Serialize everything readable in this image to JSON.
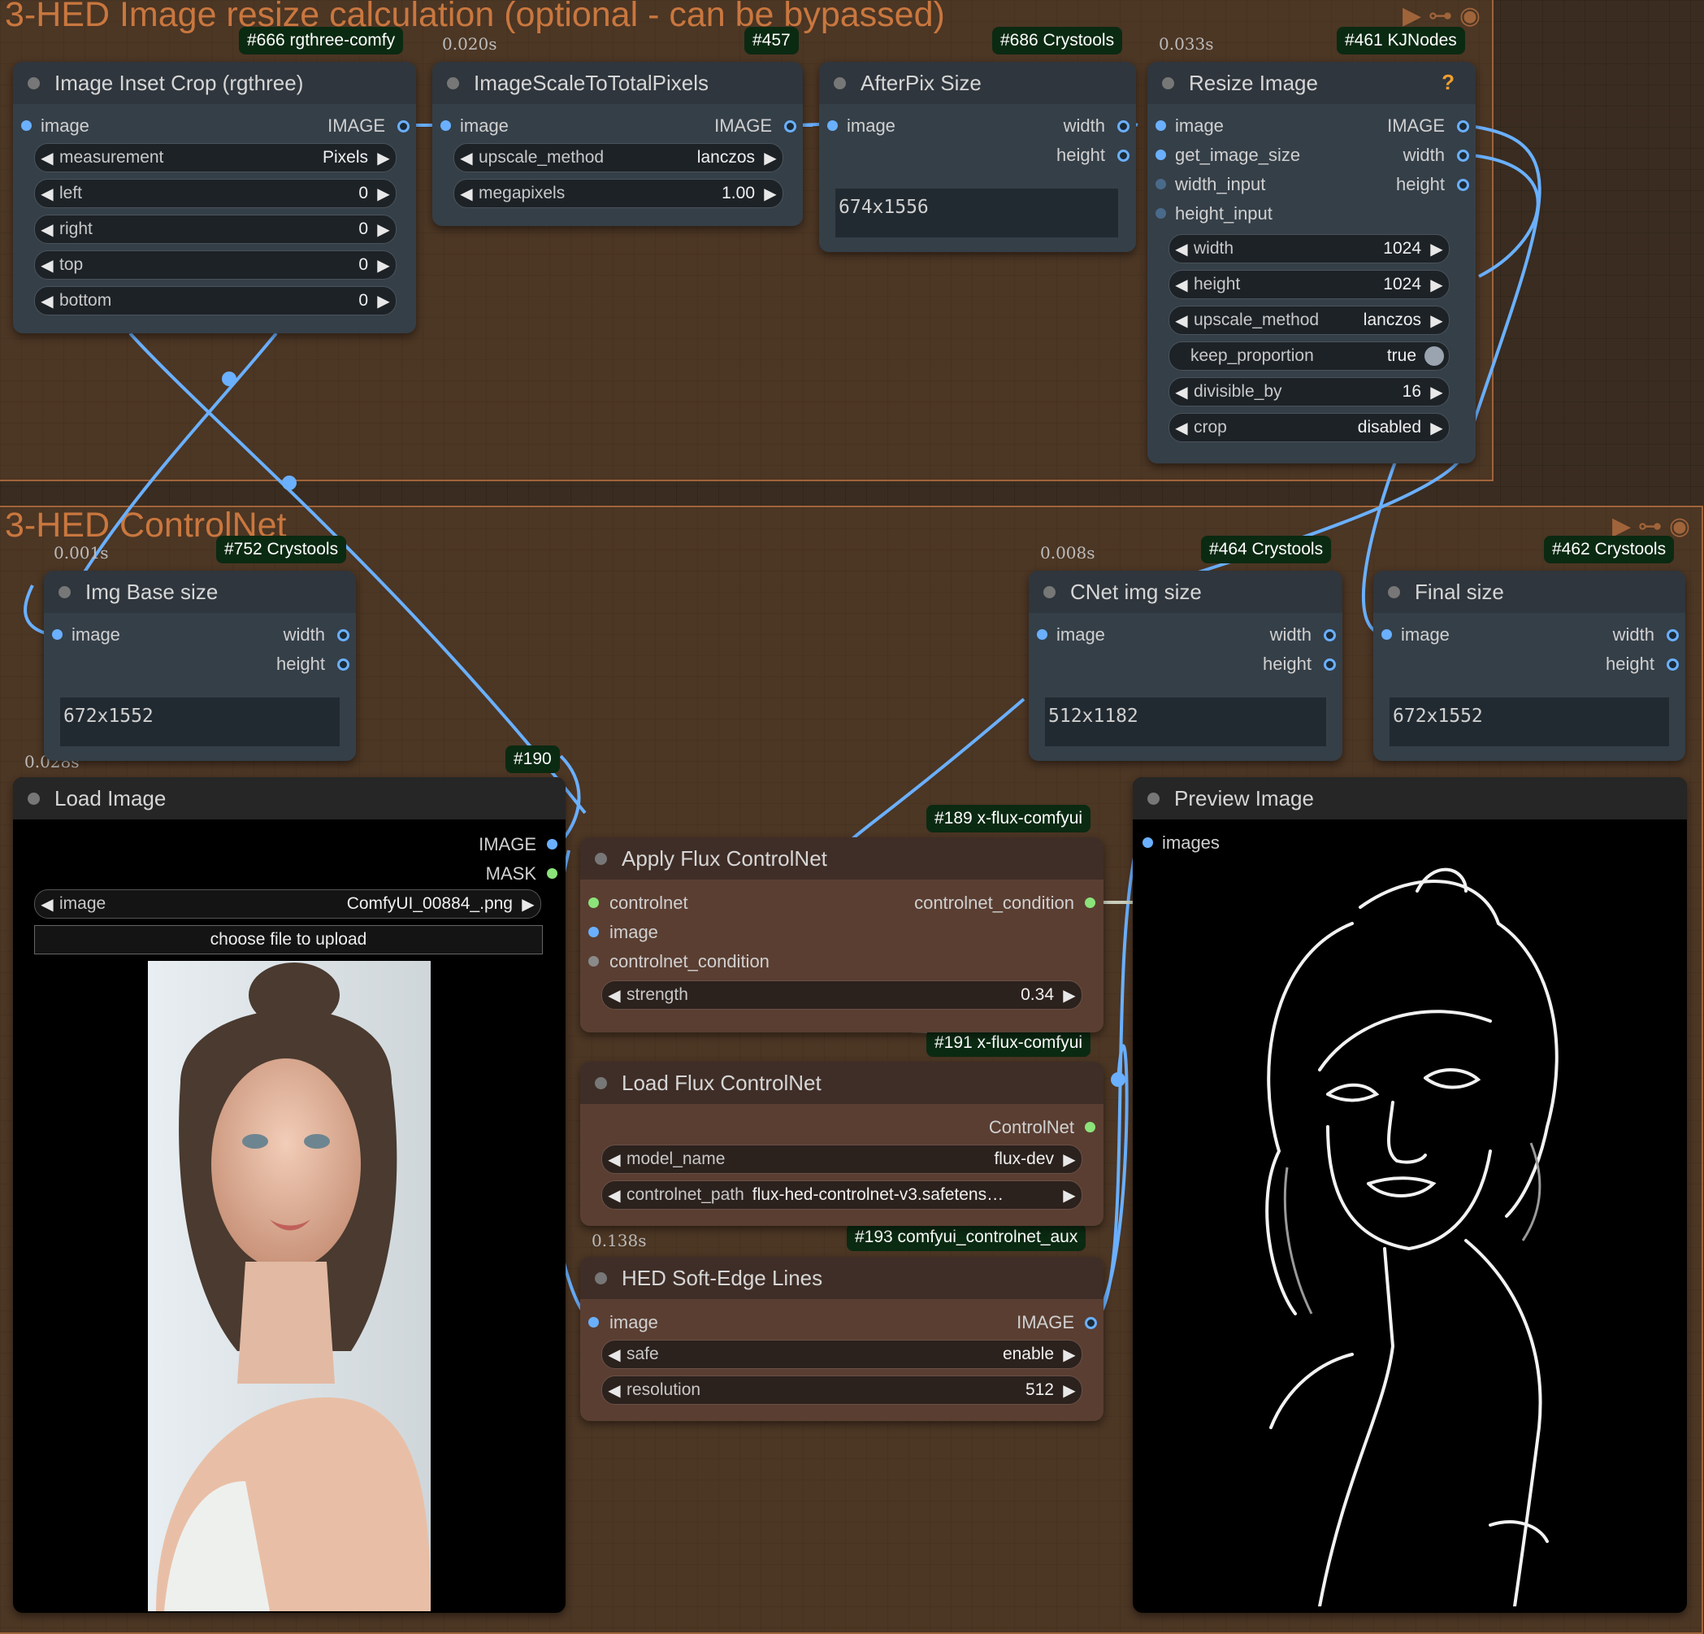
{
  "groups": {
    "resize": {
      "title": "3-HED Image resize calculation (optional - can be bypassed)"
    },
    "controlnet": {
      "title": "3-HED ControlNet"
    }
  },
  "colors": {
    "canvas": "#3a2c20",
    "group_border": "#a0643a",
    "group_title": "#c9773f",
    "node_body": "#353f48",
    "node_body_brown": "#5a3e32",
    "badge": "#0b2a12",
    "wire": "#6ab0ff",
    "wire_conditioning": "#c8cdbc",
    "pin_green": "#8be37a"
  },
  "icons": {
    "group": [
      "play-icon",
      "link-icon",
      "eye-icon"
    ],
    "help": "question-icon"
  },
  "nodes": {
    "inset_crop": {
      "title": "Image Inset Crop (rgthree)",
      "badge": "#666 rgthree-comfy",
      "input": "image",
      "output": "IMAGE",
      "widgets": [
        {
          "label": "measurement",
          "value": "Pixels"
        },
        {
          "label": "left",
          "value": "0"
        },
        {
          "label": "right",
          "value": "0"
        },
        {
          "label": "top",
          "value": "0"
        },
        {
          "label": "bottom",
          "value": "0"
        }
      ]
    },
    "scale_total": {
      "title": "ImageScaleToTotalPixels",
      "badge": "#457",
      "time": "0.020s",
      "input": "image",
      "output": "IMAGE",
      "widgets": [
        {
          "label": "upscale_method",
          "value": "lanczos"
        },
        {
          "label": "megapixels",
          "value": "1.00"
        }
      ]
    },
    "afterpix": {
      "title": "AfterPix Size",
      "badge": "#686 Crystools",
      "input": "image",
      "outputs": [
        "width",
        "height"
      ],
      "text": "674x1556"
    },
    "resize": {
      "title": "Resize Image",
      "badge": "#461 KJNodes",
      "time": "0.033s",
      "inputs": [
        "image",
        "get_image_size",
        "width_input",
        "height_input"
      ],
      "outputs": [
        "IMAGE",
        "width",
        "height"
      ],
      "widgets": [
        {
          "label": "width",
          "value": "1024"
        },
        {
          "label": "height",
          "value": "1024"
        },
        {
          "label": "upscale_method",
          "value": "lanczos"
        },
        {
          "label": "keep_proportion",
          "value": "true"
        },
        {
          "label": "divisible_by",
          "value": "16"
        },
        {
          "label": "crop",
          "value": "disabled"
        }
      ]
    },
    "base_size": {
      "title": "Img Base size",
      "badge": "#752 Crystools",
      "time": "0.001s",
      "input": "image",
      "outputs": [
        "width",
        "height"
      ],
      "text": "672x1552"
    },
    "cnet_size": {
      "title": "CNet img size",
      "badge": "#464 Crystools",
      "time": "0.008s",
      "input": "image",
      "outputs": [
        "width",
        "height"
      ],
      "text": "512x1182"
    },
    "final_size": {
      "title": "Final size",
      "badge": "#462 Crystools",
      "input": "image",
      "outputs": [
        "width",
        "height"
      ],
      "text": "672x1552"
    },
    "load_image": {
      "title": "Load Image",
      "badge": "#190",
      "time": "0.028s",
      "outputs": [
        "IMAGE",
        "MASK"
      ],
      "widget": {
        "label": "image",
        "value": "ComfyUI_00884_.png"
      },
      "button": "choose file to upload"
    },
    "apply_cn": {
      "title": "Apply Flux ControlNet",
      "badge": "#189 x-flux-comfyui",
      "inputs": [
        "controlnet",
        "image",
        "controlnet_condition"
      ],
      "output": "controlnet_condition",
      "widget": {
        "label": "strength",
        "value": "0.34"
      }
    },
    "load_cn": {
      "title": "Load Flux ControlNet",
      "badge": "#191 x-flux-comfyui",
      "output": "ControlNet",
      "widgets": [
        {
          "label": "model_name",
          "value": "flux-dev"
        },
        {
          "label": "controlnet_path",
          "value": "flux-hed-controlnet-v3.safetens…"
        }
      ]
    },
    "hed": {
      "title": "HED Soft-Edge Lines",
      "badge": "#193 comfyui_controlnet_aux",
      "time": "0.138s",
      "input": "image",
      "output": "IMAGE",
      "widgets": [
        {
          "label": "safe",
          "value": "enable"
        },
        {
          "label": "resolution",
          "value": "512"
        }
      ]
    },
    "preview": {
      "title": "Preview Image",
      "input": "images"
    }
  }
}
